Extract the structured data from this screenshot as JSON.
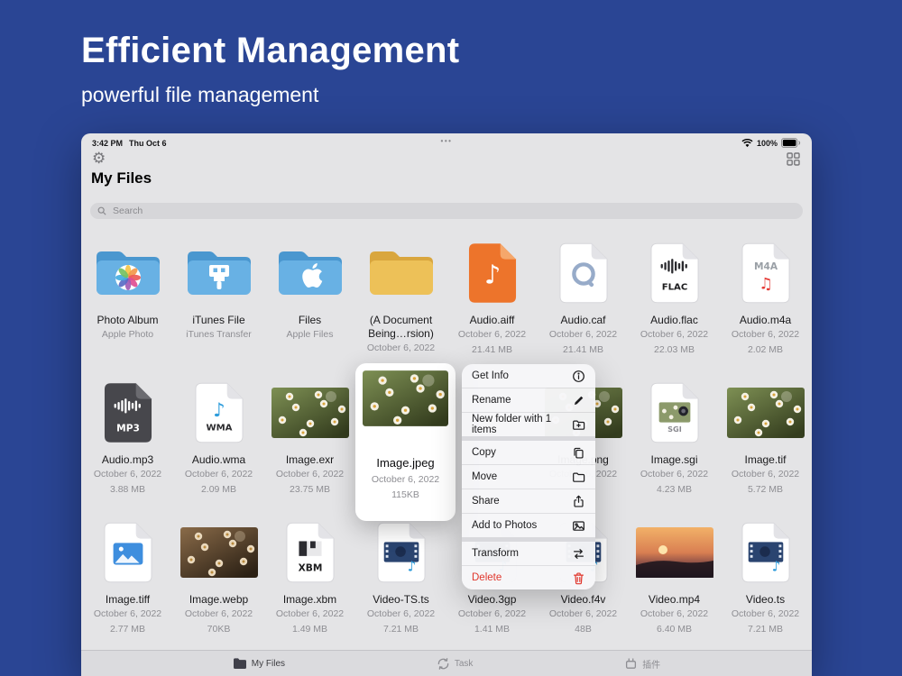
{
  "colors": {
    "page_bg": "#2a4594",
    "window_bg": "#e4e4e6",
    "folder_blue": "#68b1e4",
    "folder_yellow": "#edc158",
    "delete_red": "#e0362c"
  },
  "hero": {
    "title": "Efficient Management",
    "subtitle": "powerful file management"
  },
  "window": {
    "status_bar": {
      "time": "3:42 PM",
      "date": "Thu Oct 6",
      "handle_dots": "•••",
      "battery": "100%"
    },
    "nav": {
      "title": "My Files"
    },
    "search": {
      "placeholder": "Search"
    },
    "grid": {
      "items": [
        {
          "name": "Photo Album",
          "meta1": "Apple Photo",
          "meta2": "",
          "icon": "folder-photos"
        },
        {
          "name": "iTunes File",
          "meta1": "iTunes Transfer",
          "meta2": "",
          "icon": "folder-usb"
        },
        {
          "name": "Files",
          "meta1": "Apple Files",
          "meta2": "",
          "icon": "folder-apple"
        },
        {
          "name": "(A Document Being…rsion)",
          "meta1": "October 6, 2022",
          "meta2": "",
          "icon": "folder-plain"
        },
        {
          "name": "Audio.aiff",
          "meta1": "October 6, 2022",
          "meta2": "21.41 MB",
          "icon": "doc-aiff"
        },
        {
          "name": "Audio.caf",
          "meta1": "October 6, 2022",
          "meta2": "21.41 MB",
          "icon": "doc-caf"
        },
        {
          "name": "Audio.flac",
          "meta1": "October 6, 2022",
          "meta2": "22.03 MB",
          "icon": "doc-flac"
        },
        {
          "name": "Audio.m4a",
          "meta1": "October 6, 2022",
          "meta2": "2.02 MB",
          "icon": "doc-m4a"
        },
        {
          "name": "Audio.mp3",
          "meta1": "October 6, 2022",
          "meta2": "3.88 MB",
          "icon": "doc-mp3"
        },
        {
          "name": "Audio.wma",
          "meta1": "October 6, 2022",
          "meta2": "2.09 MB",
          "icon": "doc-wma"
        },
        {
          "name": "Image.exr",
          "meta1": "October 6, 2022",
          "meta2": "23.75 MB",
          "icon": "thumb-daisy"
        },
        {
          "name": "",
          "meta1": "",
          "meta2": "",
          "icon": ""
        },
        {
          "name": "",
          "meta1": "",
          "meta2": "",
          "icon": ""
        },
        {
          "name": "Image.png",
          "meta1": "October 6, 2022",
          "meta2": "",
          "icon": "thumb-daisy"
        },
        {
          "name": "Image.sgi",
          "meta1": "October 6, 2022",
          "meta2": "4.23 MB",
          "icon": "doc-sgi"
        },
        {
          "name": "Image.tif",
          "meta1": "October 6, 2022",
          "meta2": "5.72 MB",
          "icon": "thumb-daisy"
        },
        {
          "name": "Image.tiff",
          "meta1": "October 6, 2022",
          "meta2": "2.77 MB",
          "icon": "doc-tiff"
        },
        {
          "name": "Image.webp",
          "meta1": "October 6, 2022",
          "meta2": "70KB",
          "icon": "thumb-brown"
        },
        {
          "name": "Image.xbm",
          "meta1": "October 6, 2022",
          "meta2": "1.49 MB",
          "icon": "doc-xbm"
        },
        {
          "name": "Video-TS.ts",
          "meta1": "October 6, 2022",
          "meta2": "7.21 MB",
          "icon": "doc-video"
        },
        {
          "name": "Video.3gp",
          "meta1": "October 6, 2022",
          "meta2": "1.41 MB",
          "icon": "doc-video"
        },
        {
          "name": "Video.f4v",
          "meta1": "October 6, 2022",
          "meta2": "48B",
          "icon": "doc-video"
        },
        {
          "name": "Video.mp4",
          "meta1": "October 6, 2022",
          "meta2": "6.40 MB",
          "icon": "thumb-sunset"
        },
        {
          "name": "Video.ts",
          "meta1": "October 6, 2022",
          "meta2": "7.21 MB",
          "icon": "doc-video"
        }
      ]
    },
    "popup": {
      "name": "Image.jpeg",
      "date": "October 6, 2022",
      "size": "115KB",
      "thumb_icon": "thumb-daisy"
    },
    "context_menu": {
      "groups": [
        [
          {
            "label": "Get Info",
            "icon": "info-circle-icon"
          },
          {
            "label": "Rename",
            "icon": "pencil-icon"
          },
          {
            "label": "New folder with 1 items",
            "icon": "new-folder-icon"
          }
        ],
        [
          {
            "label": "Copy",
            "icon": "copy-icon"
          },
          {
            "label": "Move",
            "icon": "move-folder-icon"
          },
          {
            "label": "Share",
            "icon": "share-icon"
          },
          {
            "label": "Add to Photos",
            "icon": "add-photos-icon"
          }
        ],
        [
          {
            "label": "Transform",
            "icon": "transform-icon"
          },
          {
            "label": "Delete",
            "icon": "trash-icon",
            "danger": true
          }
        ]
      ]
    },
    "tab_bar": {
      "tabs": [
        {
          "key": "my-files",
          "label": "My Files",
          "icon": "tab-folder-icon",
          "active": true
        },
        {
          "key": "task",
          "label": "Task",
          "icon": "tab-task-icon",
          "active": false
        },
        {
          "key": "plugin",
          "label": "插件",
          "icon": "tab-plugin-icon",
          "active": false
        }
      ]
    }
  }
}
